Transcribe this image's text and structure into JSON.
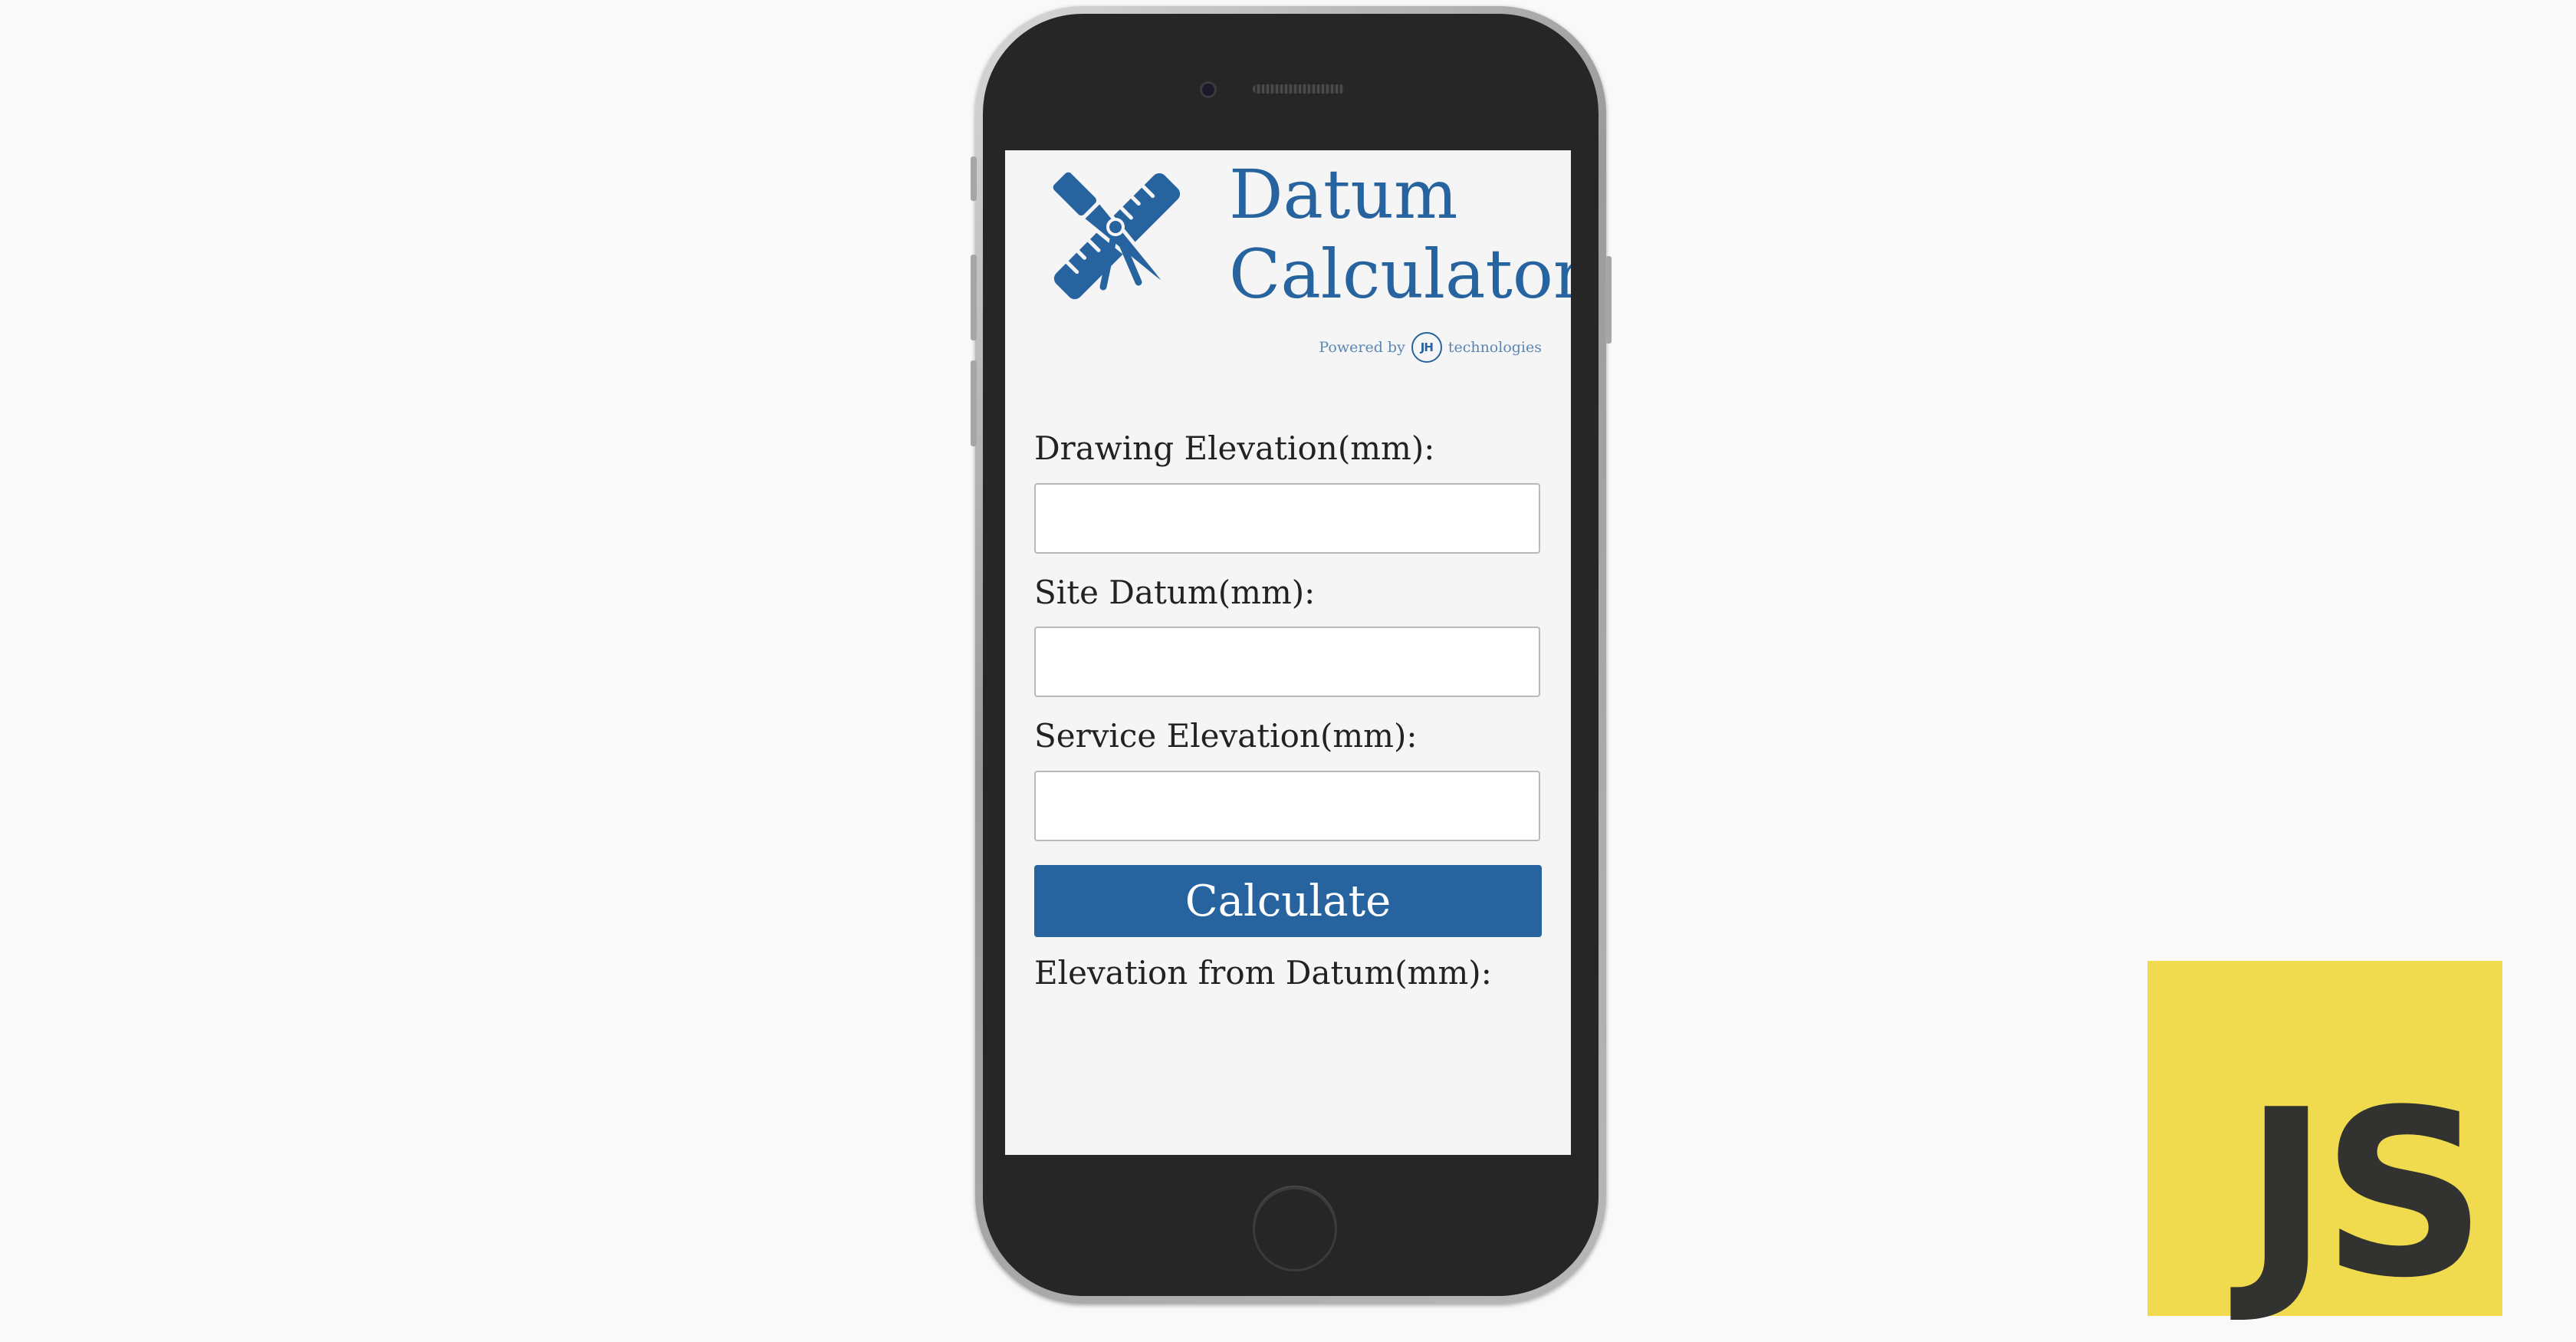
{
  "app": {
    "title_line1": "Datum",
    "title_line2": "Calculator",
    "powered_by": "Powered by",
    "brand_initials": "JH",
    "brand_suffix": "technologies",
    "logo_icon": "ruler-compass-icon"
  },
  "form": {
    "fields": [
      {
        "label": "Drawing Elevation(mm):",
        "value": "",
        "placeholder": ""
      },
      {
        "label": "Site Datum(mm):",
        "value": "",
        "placeholder": ""
      },
      {
        "label": "Service Elevation(mm):",
        "value": "",
        "placeholder": ""
      }
    ],
    "calculate_label": "Calculate",
    "result_label": "Elevation from Datum(mm):"
  },
  "badge": {
    "text": "JS"
  },
  "colors": {
    "brand_blue": "#27649f",
    "js_yellow": "#f0db4f",
    "js_text": "#323330"
  }
}
